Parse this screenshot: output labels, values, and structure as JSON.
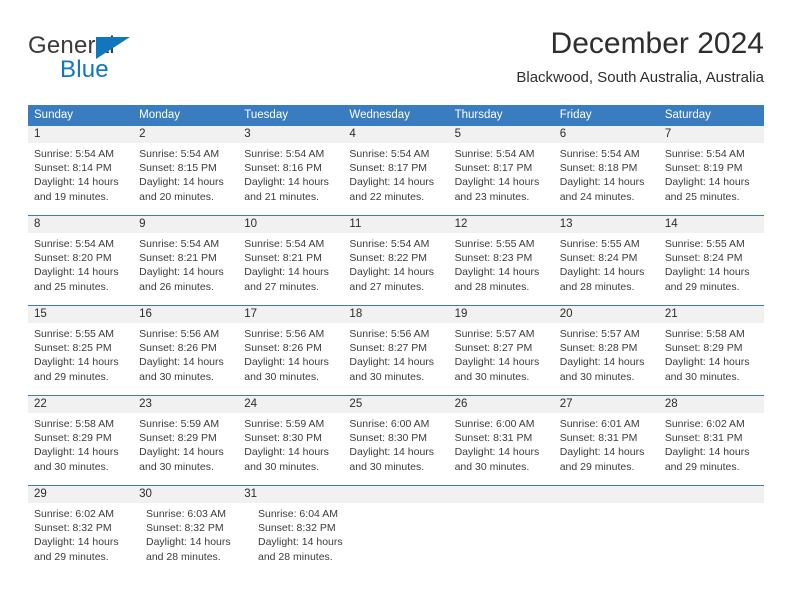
{
  "brand": {
    "word_general": "General",
    "word_blue": "Blue"
  },
  "header": {
    "month_title": "December 2024",
    "location": "Blackwood, South Australia, Australia"
  },
  "colors": {
    "header_blue": "#3a7cc0",
    "brand_blue": "#1077bd",
    "daynumber_band": "#f1f1f1",
    "text": "#3c3c3c"
  },
  "weekdays": [
    "Sunday",
    "Monday",
    "Tuesday",
    "Wednesday",
    "Thursday",
    "Friday",
    "Saturday"
  ],
  "weeks": [
    {
      "days": [
        {
          "num": "1",
          "sunrise": "Sunrise: 5:54 AM",
          "sunset": "Sunset: 8:14 PM",
          "daylight1": "Daylight: 14 hours",
          "daylight2": "and 19 minutes."
        },
        {
          "num": "2",
          "sunrise": "Sunrise: 5:54 AM",
          "sunset": "Sunset: 8:15 PM",
          "daylight1": "Daylight: 14 hours",
          "daylight2": "and 20 minutes."
        },
        {
          "num": "3",
          "sunrise": "Sunrise: 5:54 AM",
          "sunset": "Sunset: 8:16 PM",
          "daylight1": "Daylight: 14 hours",
          "daylight2": "and 21 minutes."
        },
        {
          "num": "4",
          "sunrise": "Sunrise: 5:54 AM",
          "sunset": "Sunset: 8:17 PM",
          "daylight1": "Daylight: 14 hours",
          "daylight2": "and 22 minutes."
        },
        {
          "num": "5",
          "sunrise": "Sunrise: 5:54 AM",
          "sunset": "Sunset: 8:17 PM",
          "daylight1": "Daylight: 14 hours",
          "daylight2": "and 23 minutes."
        },
        {
          "num": "6",
          "sunrise": "Sunrise: 5:54 AM",
          "sunset": "Sunset: 8:18 PM",
          "daylight1": "Daylight: 14 hours",
          "daylight2": "and 24 minutes."
        },
        {
          "num": "7",
          "sunrise": "Sunrise: 5:54 AM",
          "sunset": "Sunset: 8:19 PM",
          "daylight1": "Daylight: 14 hours",
          "daylight2": "and 25 minutes."
        }
      ]
    },
    {
      "days": [
        {
          "num": "8",
          "sunrise": "Sunrise: 5:54 AM",
          "sunset": "Sunset: 8:20 PM",
          "daylight1": "Daylight: 14 hours",
          "daylight2": "and 25 minutes."
        },
        {
          "num": "9",
          "sunrise": "Sunrise: 5:54 AM",
          "sunset": "Sunset: 8:21 PM",
          "daylight1": "Daylight: 14 hours",
          "daylight2": "and 26 minutes."
        },
        {
          "num": "10",
          "sunrise": "Sunrise: 5:54 AM",
          "sunset": "Sunset: 8:21 PM",
          "daylight1": "Daylight: 14 hours",
          "daylight2": "and 27 minutes."
        },
        {
          "num": "11",
          "sunrise": "Sunrise: 5:54 AM",
          "sunset": "Sunset: 8:22 PM",
          "daylight1": "Daylight: 14 hours",
          "daylight2": "and 27 minutes."
        },
        {
          "num": "12",
          "sunrise": "Sunrise: 5:55 AM",
          "sunset": "Sunset: 8:23 PM",
          "daylight1": "Daylight: 14 hours",
          "daylight2": "and 28 minutes."
        },
        {
          "num": "13",
          "sunrise": "Sunrise: 5:55 AM",
          "sunset": "Sunset: 8:24 PM",
          "daylight1": "Daylight: 14 hours",
          "daylight2": "and 28 minutes."
        },
        {
          "num": "14",
          "sunrise": "Sunrise: 5:55 AM",
          "sunset": "Sunset: 8:24 PM",
          "daylight1": "Daylight: 14 hours",
          "daylight2": "and 29 minutes."
        }
      ]
    },
    {
      "days": [
        {
          "num": "15",
          "sunrise": "Sunrise: 5:55 AM",
          "sunset": "Sunset: 8:25 PM",
          "daylight1": "Daylight: 14 hours",
          "daylight2": "and 29 minutes."
        },
        {
          "num": "16",
          "sunrise": "Sunrise: 5:56 AM",
          "sunset": "Sunset: 8:26 PM",
          "daylight1": "Daylight: 14 hours",
          "daylight2": "and 30 minutes."
        },
        {
          "num": "17",
          "sunrise": "Sunrise: 5:56 AM",
          "sunset": "Sunset: 8:26 PM",
          "daylight1": "Daylight: 14 hours",
          "daylight2": "and 30 minutes."
        },
        {
          "num": "18",
          "sunrise": "Sunrise: 5:56 AM",
          "sunset": "Sunset: 8:27 PM",
          "daylight1": "Daylight: 14 hours",
          "daylight2": "and 30 minutes."
        },
        {
          "num": "19",
          "sunrise": "Sunrise: 5:57 AM",
          "sunset": "Sunset: 8:27 PM",
          "daylight1": "Daylight: 14 hours",
          "daylight2": "and 30 minutes."
        },
        {
          "num": "20",
          "sunrise": "Sunrise: 5:57 AM",
          "sunset": "Sunset: 8:28 PM",
          "daylight1": "Daylight: 14 hours",
          "daylight2": "and 30 minutes."
        },
        {
          "num": "21",
          "sunrise": "Sunrise: 5:58 AM",
          "sunset": "Sunset: 8:29 PM",
          "daylight1": "Daylight: 14 hours",
          "daylight2": "and 30 minutes."
        }
      ]
    },
    {
      "days": [
        {
          "num": "22",
          "sunrise": "Sunrise: 5:58 AM",
          "sunset": "Sunset: 8:29 PM",
          "daylight1": "Daylight: 14 hours",
          "daylight2": "and 30 minutes."
        },
        {
          "num": "23",
          "sunrise": "Sunrise: 5:59 AM",
          "sunset": "Sunset: 8:29 PM",
          "daylight1": "Daylight: 14 hours",
          "daylight2": "and 30 minutes."
        },
        {
          "num": "24",
          "sunrise": "Sunrise: 5:59 AM",
          "sunset": "Sunset: 8:30 PM",
          "daylight1": "Daylight: 14 hours",
          "daylight2": "and 30 minutes."
        },
        {
          "num": "25",
          "sunrise": "Sunrise: 6:00 AM",
          "sunset": "Sunset: 8:30 PM",
          "daylight1": "Daylight: 14 hours",
          "daylight2": "and 30 minutes."
        },
        {
          "num": "26",
          "sunrise": "Sunrise: 6:00 AM",
          "sunset": "Sunset: 8:31 PM",
          "daylight1": "Daylight: 14 hours",
          "daylight2": "and 30 minutes."
        },
        {
          "num": "27",
          "sunrise": "Sunrise: 6:01 AM",
          "sunset": "Sunset: 8:31 PM",
          "daylight1": "Daylight: 14 hours",
          "daylight2": "and 29 minutes."
        },
        {
          "num": "28",
          "sunrise": "Sunrise: 6:02 AM",
          "sunset": "Sunset: 8:31 PM",
          "daylight1": "Daylight: 14 hours",
          "daylight2": "and 29 minutes."
        }
      ]
    },
    {
      "days": [
        {
          "num": "29",
          "sunrise": "Sunrise: 6:02 AM",
          "sunset": "Sunset: 8:32 PM",
          "daylight1": "Daylight: 14 hours",
          "daylight2": "and 29 minutes."
        },
        {
          "num": "30",
          "sunrise": "Sunrise: 6:03 AM",
          "sunset": "Sunset: 8:32 PM",
          "daylight1": "Daylight: 14 hours",
          "daylight2": "and 28 minutes."
        },
        {
          "num": "31",
          "sunrise": "Sunrise: 6:04 AM",
          "sunset": "Sunset: 8:32 PM",
          "daylight1": "Daylight: 14 hours",
          "daylight2": "and 28 minutes."
        }
      ]
    }
  ]
}
